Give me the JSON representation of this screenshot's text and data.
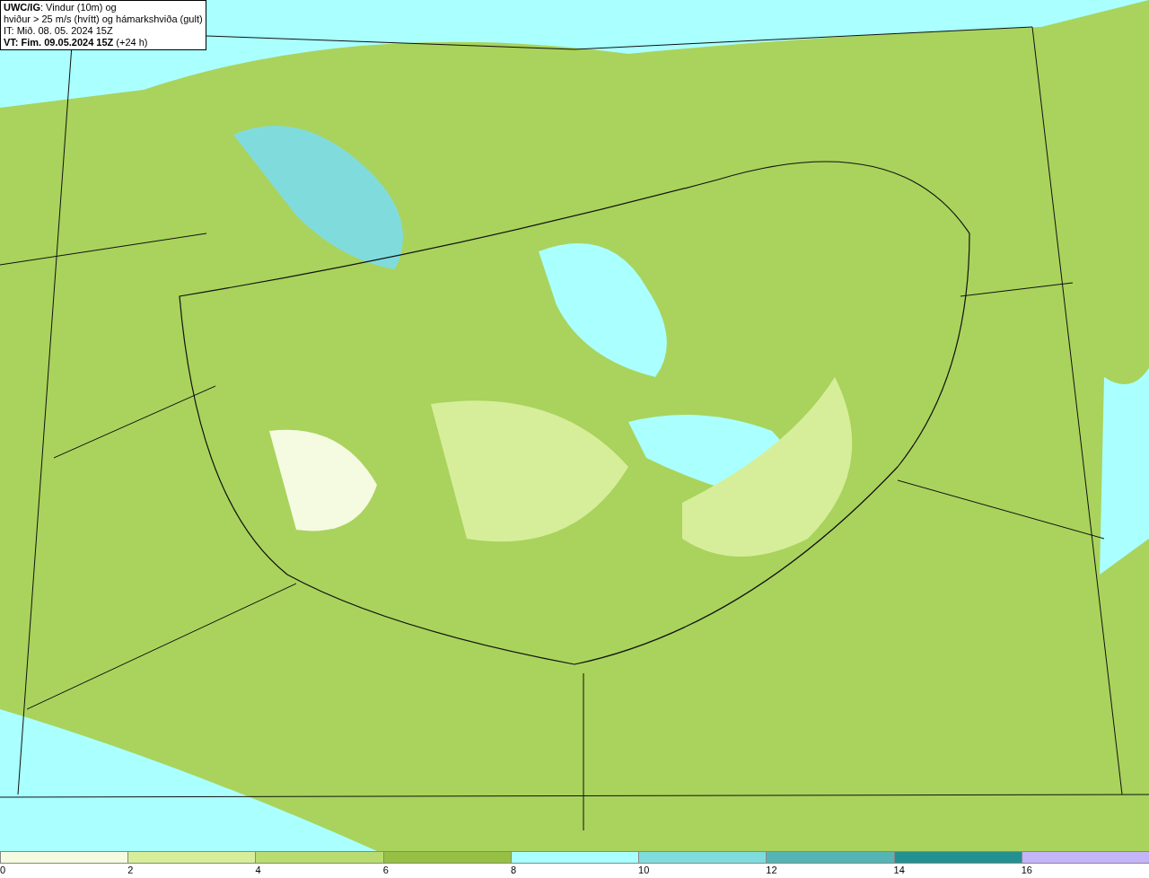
{
  "title_box": {
    "lines": [
      "**UWC/IG**: Vindur (10m) og",
      "hviður > 25 m/s (hvítt) og hámarkshviða (gult)",
      "IT: Mið. 08. 05. 2024 15Z",
      "**VT: Fim. 09.05.2024 15Z** (+24 h)"
    ]
  },
  "legend": {
    "bins": [
      {
        "label": "0",
        "color": "#f4fbe0"
      },
      {
        "label": "2",
        "color": "#d6ee9a"
      },
      {
        "label": "4",
        "color": "#b8dc72"
      },
      {
        "label": "6",
        "color": "#96c044"
      },
      {
        "label": "8",
        "color": "#aaffff"
      },
      {
        "label": "10",
        "color": "#80dcdc"
      },
      {
        "label": "12",
        "color": "#56b4b4"
      },
      {
        "label": "14",
        "color": "#259090"
      },
      {
        "label": "16",
        "color": "#c4b4f8"
      }
    ]
  }
}
